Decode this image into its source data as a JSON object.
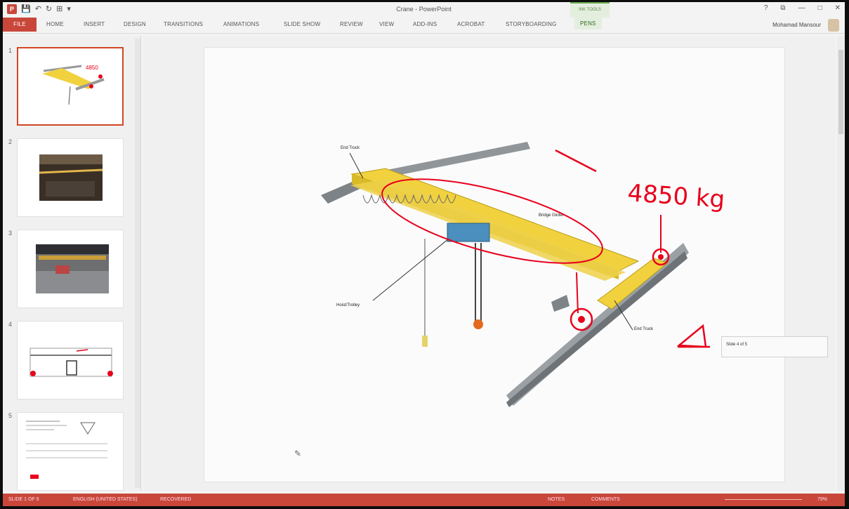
{
  "window": {
    "title": "Crane - PowerPoint",
    "context_tab_group": "INK TOOLS",
    "user_name": "Mohamad Mansour",
    "controls": [
      "?",
      "⧉",
      "—",
      "□",
      "✕"
    ]
  },
  "qat": {
    "app_icon": "P",
    "save": "💾",
    "undo": "↶",
    "redo": "↻",
    "present": "⊞",
    "customize": "▾"
  },
  "ribbon": {
    "tabs": [
      {
        "label": "FILE"
      },
      {
        "label": "HOME"
      },
      {
        "label": "INSERT"
      },
      {
        "label": "DESIGN"
      },
      {
        "label": "TRANSITIONS"
      },
      {
        "label": "ANIMATIONS"
      },
      {
        "label": "SLIDE SHOW"
      },
      {
        "label": "REVIEW"
      },
      {
        "label": "VIEW"
      },
      {
        "label": "ADD-INS"
      },
      {
        "label": "ACROBAT"
      },
      {
        "label": "STORYBOARDING"
      },
      {
        "label": "PENS"
      }
    ]
  },
  "thumbnails": [
    {
      "number": "1",
      "selected": true
    },
    {
      "number": "2",
      "selected": false
    },
    {
      "number": "3",
      "selected": false
    },
    {
      "number": "4",
      "selected": false
    },
    {
      "number": "5",
      "selected": false
    }
  ],
  "slide": {
    "labels": {
      "end_truck_top": "End Truck",
      "end_truck_bottom": "End Truck",
      "bridge_girder": "Bridge Girder",
      "hoist_trolley": "Hoist/Trolley"
    },
    "ink_text": "4850 kg",
    "ink_color": "#e8001c",
    "girder_color": "#f1d23e",
    "rail_color": "#8f9599"
  },
  "tooltip": {
    "text": "Slide 4 of 5"
  },
  "statusbar": {
    "slide_indicator": "SLIDE 1 OF 5",
    "spelling": "ENGLISH (UNITED STATES)",
    "recovered": "RECOVERED",
    "notes": "NOTES",
    "comments": "COMMENTS",
    "zoom": "79%"
  },
  "colors": {
    "accent": "#c9473a",
    "pens_tab": "#e4eede"
  }
}
